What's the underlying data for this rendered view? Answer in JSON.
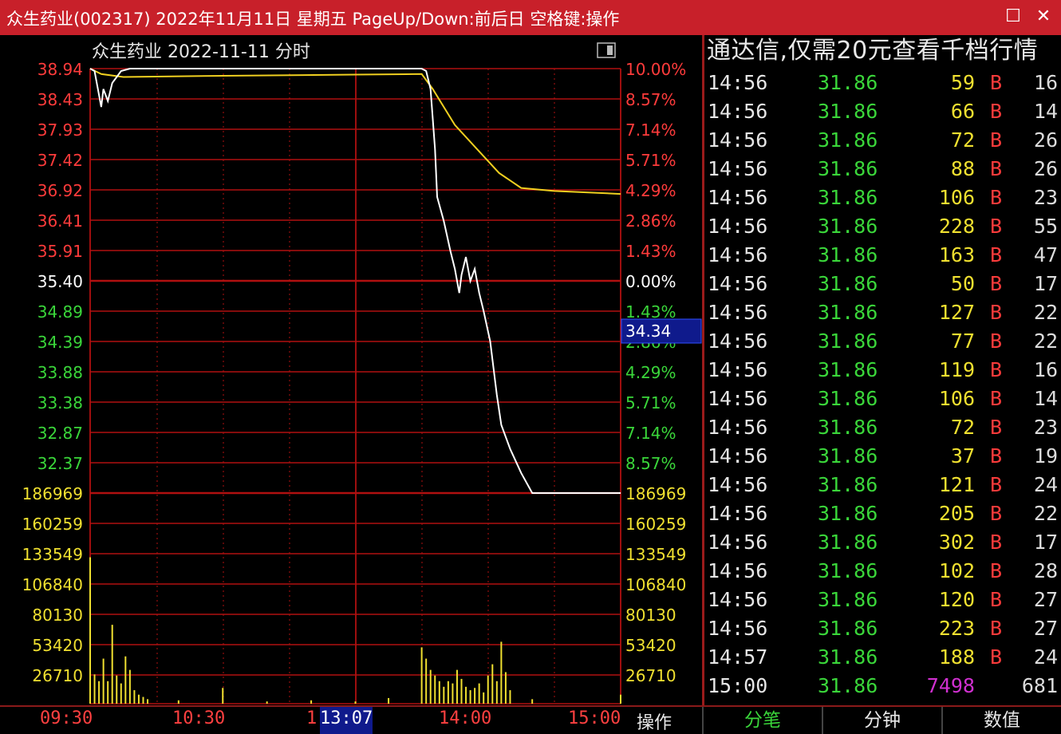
{
  "window": {
    "title": "众生药业(002317) 2022年11月11日 星期五 PageUp/Down:前后日 空格键:操作",
    "maximize_icon": "maximize-icon",
    "close_icon": "close-icon"
  },
  "chart": {
    "header": "众生药业  2022-11-11 分时",
    "cursor_price": "34.34",
    "cursor_time": "13:07",
    "left_labels": [
      "38.94",
      "38.43",
      "37.93",
      "37.42",
      "36.92",
      "36.41",
      "35.91",
      "35.40",
      "34.89",
      "34.39",
      "33.88",
      "33.38",
      "32.87",
      "32.37",
      "186969",
      "160259",
      "133549",
      "106840",
      "80130",
      "53420",
      "26710"
    ],
    "right_labels": [
      "10.00%",
      "8.57%",
      "7.14%",
      "5.71%",
      "4.29%",
      "2.86%",
      "1.43%",
      "0.00%",
      "1.43%",
      "2.86%",
      "4.29%",
      "5.71%",
      "7.14%",
      "8.57%",
      "186969",
      "160259",
      "133549",
      "106840",
      "80130",
      "53420",
      "26710"
    ],
    "label_colors": [
      "#ff3b3b",
      "#ff3b3b",
      "#ff3b3b",
      "#ff3b3b",
      "#ff3b3b",
      "#ff3b3b",
      "#ff3b3b",
      "#ffffff",
      "#3ad63a",
      "#3ad63a",
      "#3ad63a",
      "#3ad63a",
      "#3ad63a",
      "#3ad63a",
      "#f0e030",
      "#f0e030",
      "#f0e030",
      "#f0e030",
      "#f0e030",
      "#f0e030",
      "#f0e030"
    ]
  },
  "chart_data": {
    "type": "line",
    "title": "众生药业  2022-11-11 分时",
    "ylim": [
      32.37,
      38.94
    ],
    "reference_price": 35.4,
    "series": [
      {
        "values": [
          [
            0,
            38.94
          ],
          [
            2,
            38.9
          ],
          [
            3,
            38.7
          ],
          [
            5,
            38.3
          ],
          [
            6,
            38.6
          ],
          [
            8,
            38.4
          ],
          [
            10,
            38.7
          ],
          [
            12,
            38.8
          ],
          [
            14,
            38.9
          ],
          [
            18,
            38.94
          ],
          [
            60,
            38.94
          ],
          [
            120,
            38.94
          ],
          [
            150,
            38.94
          ],
          [
            152,
            38.9
          ],
          [
            154,
            38.6
          ],
          [
            156,
            37.6
          ],
          [
            157,
            36.8
          ],
          [
            160,
            36.4
          ],
          [
            163,
            35.9
          ],
          [
            165,
            35.6
          ],
          [
            167,
            35.2
          ],
          [
            168,
            35.5
          ],
          [
            170,
            35.8
          ],
          [
            172,
            35.4
          ],
          [
            174,
            35.6
          ],
          [
            176,
            35.2
          ],
          [
            178,
            34.9
          ],
          [
            181,
            34.39
          ],
          [
            184,
            33.5
          ],
          [
            186,
            33.0
          ],
          [
            190,
            32.6
          ],
          [
            195,
            32.2
          ],
          [
            200,
            31.86
          ],
          [
            210,
            31.86
          ],
          [
            240,
            31.86
          ]
        ]
      },
      {
        "values": [
          [
            0,
            38.94
          ],
          [
            5,
            38.85
          ],
          [
            15,
            38.8
          ],
          [
            60,
            38.82
          ],
          [
            120,
            38.84
          ],
          [
            150,
            38.85
          ],
          [
            155,
            38.6
          ],
          [
            165,
            38.0
          ],
          [
            175,
            37.6
          ],
          [
            185,
            37.2
          ],
          [
            195,
            36.95
          ],
          [
            210,
            36.9
          ],
          [
            240,
            36.85
          ]
        ]
      }
    ],
    "volume": {
      "ylim": [
        0,
        186969
      ],
      "values": [
        [
          0,
          130000
        ],
        [
          2,
          26000
        ],
        [
          4,
          20000
        ],
        [
          6,
          40000
        ],
        [
          8,
          20000
        ],
        [
          10,
          70000
        ],
        [
          12,
          25000
        ],
        [
          14,
          18000
        ],
        [
          16,
          42000
        ],
        [
          18,
          30000
        ],
        [
          20,
          12000
        ],
        [
          22,
          8000
        ],
        [
          24,
          6000
        ],
        [
          26,
          4000
        ],
        [
          40,
          3000
        ],
        [
          60,
          14000
        ],
        [
          80,
          2000
        ],
        [
          100,
          3000
        ],
        [
          120,
          2000
        ],
        [
          135,
          5000
        ],
        [
          150,
          50000
        ],
        [
          152,
          40000
        ],
        [
          154,
          30000
        ],
        [
          156,
          25000
        ],
        [
          158,
          20000
        ],
        [
          160,
          15000
        ],
        [
          162,
          20000
        ],
        [
          164,
          18000
        ],
        [
          166,
          30000
        ],
        [
          168,
          22000
        ],
        [
          170,
          15000
        ],
        [
          172,
          12000
        ],
        [
          174,
          14000
        ],
        [
          176,
          18000
        ],
        [
          178,
          10000
        ],
        [
          180,
          25000
        ],
        [
          182,
          35000
        ],
        [
          184,
          20000
        ],
        [
          186,
          55000
        ],
        [
          188,
          28000
        ],
        [
          190,
          12000
        ],
        [
          200,
          4000
        ],
        [
          240,
          8000
        ]
      ]
    }
  },
  "ticker": {
    "header": "通达信,仅需20元查看千档行情",
    "rows": [
      {
        "time": "14:56",
        "price": "31.86",
        "vol": "59",
        "side": "B",
        "count": "16"
      },
      {
        "time": "14:56",
        "price": "31.86",
        "vol": "66",
        "side": "B",
        "count": "14"
      },
      {
        "time": "14:56",
        "price": "31.86",
        "vol": "72",
        "side": "B",
        "count": "26"
      },
      {
        "time": "14:56",
        "price": "31.86",
        "vol": "88",
        "side": "B",
        "count": "26"
      },
      {
        "time": "14:56",
        "price": "31.86",
        "vol": "106",
        "side": "B",
        "count": "23"
      },
      {
        "time": "14:56",
        "price": "31.86",
        "vol": "228",
        "side": "B",
        "count": "55"
      },
      {
        "time": "14:56",
        "price": "31.86",
        "vol": "163",
        "side": "B",
        "count": "47"
      },
      {
        "time": "14:56",
        "price": "31.86",
        "vol": "50",
        "side": "B",
        "count": "17"
      },
      {
        "time": "14:56",
        "price": "31.86",
        "vol": "127",
        "side": "B",
        "count": "22"
      },
      {
        "time": "14:56",
        "price": "31.86",
        "vol": "77",
        "side": "B",
        "count": "22"
      },
      {
        "time": "14:56",
        "price": "31.86",
        "vol": "119",
        "side": "B",
        "count": "16"
      },
      {
        "time": "14:56",
        "price": "31.86",
        "vol": "106",
        "side": "B",
        "count": "14"
      },
      {
        "time": "14:56",
        "price": "31.86",
        "vol": "72",
        "side": "B",
        "count": "23"
      },
      {
        "time": "14:56",
        "price": "31.86",
        "vol": "37",
        "side": "B",
        "count": "19"
      },
      {
        "time": "14:56",
        "price": "31.86",
        "vol": "121",
        "side": "B",
        "count": "24"
      },
      {
        "time": "14:56",
        "price": "31.86",
        "vol": "205",
        "side": "B",
        "count": "22"
      },
      {
        "time": "14:56",
        "price": "31.86",
        "vol": "302",
        "side": "B",
        "count": "17"
      },
      {
        "time": "14:56",
        "price": "31.86",
        "vol": "102",
        "side": "B",
        "count": "28"
      },
      {
        "time": "14:56",
        "price": "31.86",
        "vol": "120",
        "side": "B",
        "count": "27"
      },
      {
        "time": "14:56",
        "price": "31.86",
        "vol": "223",
        "side": "B",
        "count": "27"
      },
      {
        "time": "14:57",
        "price": "31.86",
        "vol": "188",
        "side": "B",
        "count": "24"
      },
      {
        "time": "15:00",
        "price": "31.86",
        "vol": "7498",
        "side": "",
        "count": "681"
      }
    ]
  },
  "bottom": {
    "times": [
      "09:30",
      "10:30",
      "1",
      "14:00",
      "15:00"
    ],
    "cursor_time": "13:07",
    "operate": "操作",
    "tabs": [
      "分笔",
      "分钟",
      "数值"
    ]
  },
  "colors": {
    "title_bg": "#c8202a",
    "grid": "#b01010",
    "price_line": "#ffffff",
    "avg_line": "#f0d020",
    "volume": "#f0e030",
    "up": "#ff3b3b",
    "down": "#3ad63a",
    "cursor_bg": "#0f1a8c",
    "big_vol": "#d030d0"
  }
}
